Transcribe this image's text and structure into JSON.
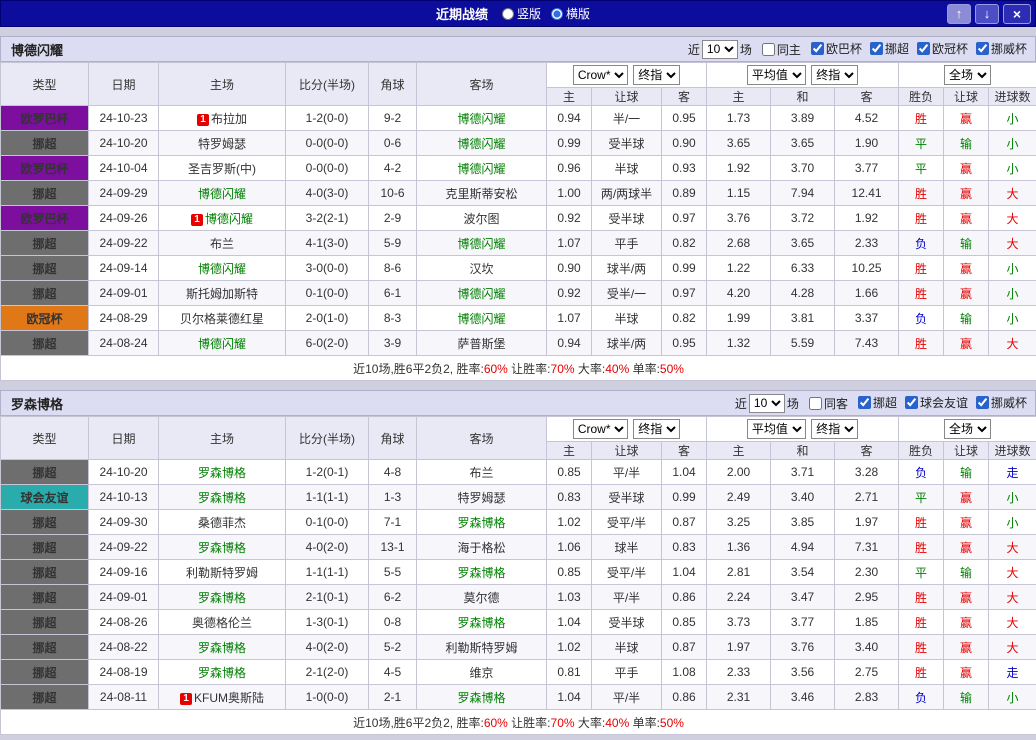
{
  "palette": {
    "focus_team": "#008000",
    "score": "#e60000",
    "accent": "#0d0d9d"
  },
  "result_colors": {
    "胜": "#e60000",
    "平": "#008000",
    "负": "#0000cc",
    "赢": "#e60000",
    "输": "#008000",
    "大": "#e60000",
    "小": "#008000",
    "走": "#0000cc"
  },
  "type_colors": {
    "挪超": "#6e6e6e",
    "欧罗巴杯": "#7d0f9e",
    "欧冠杯": "#e07818",
    "球会友谊": "#2aacac"
  },
  "topbar": {
    "title": "近期战绩",
    "radios": [
      {
        "label": "竖版",
        "selected": false
      },
      {
        "label": "横版",
        "selected": true
      }
    ],
    "up": "↑",
    "down": "↓",
    "close": "×"
  },
  "columns": {
    "type": "类型",
    "date": "日期",
    "home": "主场",
    "score": "比分(半场)",
    "corners": "角球",
    "away": "客场",
    "crow": "Crow*",
    "final1": "终指",
    "avg": "平均值",
    "final2": "终指",
    "full": "全场",
    "h1": "主",
    "hcap1": "让球",
    "a1": "客",
    "h2": "主",
    "draw2": "和",
    "a2": "客",
    "wdl": "胜负",
    "hcap2": "让球",
    "goals": "进球数"
  },
  "filter_labels": {
    "near": "近",
    "count": "10",
    "games": "场"
  },
  "sections": [
    {
      "team": "博德闪耀",
      "same_label": "同主",
      "same_checked": false,
      "leagues": [
        {
          "label": "欧巴杯",
          "checked": true
        },
        {
          "label": "挪超",
          "checked": true
        },
        {
          "label": "欧冠杯",
          "checked": true
        },
        {
          "label": "挪威杯",
          "checked": true
        }
      ],
      "rows": [
        {
          "type": "欧罗巴杯",
          "date": "24-10-23",
          "home": "布拉加",
          "hb": true,
          "hg": false,
          "score": "1-2(0-0)",
          "corners": "9-2",
          "away": "博德闪耀",
          "ab": false,
          "ag": true,
          "o": [
            "0.94",
            "半/一",
            "0.95"
          ],
          "avg": [
            "1.73",
            "3.89",
            "4.52"
          ],
          "res": [
            "胜",
            "赢",
            "小"
          ]
        },
        {
          "type": "挪超",
          "date": "24-10-20",
          "home": "特罗姆瑟",
          "hb": false,
          "hg": false,
          "score": "0-0(0-0)",
          "corners": "0-6",
          "away": "博德闪耀",
          "ab": false,
          "ag": true,
          "o": [
            "0.99",
            "受半球",
            "0.90"
          ],
          "avg": [
            "3.65",
            "3.65",
            "1.90"
          ],
          "res": [
            "平",
            "输",
            "小"
          ]
        },
        {
          "type": "欧罗巴杯",
          "date": "24-10-04",
          "home": "圣吉罗斯(中)",
          "hb": false,
          "hg": false,
          "score": "0-0(0-0)",
          "corners": "4-2",
          "away": "博德闪耀",
          "ab": false,
          "ag": true,
          "o": [
            "0.96",
            "半球",
            "0.93"
          ],
          "avg": [
            "1.92",
            "3.70",
            "3.77"
          ],
          "res": [
            "平",
            "赢",
            "小"
          ]
        },
        {
          "type": "挪超",
          "date": "24-09-29",
          "home": "博德闪耀",
          "hb": false,
          "hg": true,
          "score": "4-0(3-0)",
          "corners": "10-6",
          "away": "克里斯蒂安松",
          "ab": false,
          "ag": false,
          "o": [
            "1.00",
            "两/两球半",
            "0.89"
          ],
          "avg": [
            "1.15",
            "7.94",
            "12.41"
          ],
          "res": [
            "胜",
            "赢",
            "大"
          ]
        },
        {
          "type": "欧罗巴杯",
          "date": "24-09-26",
          "home": "博德闪耀",
          "hb": true,
          "hg": true,
          "score": "3-2(2-1)",
          "corners": "2-9",
          "away": "波尔图",
          "ab": false,
          "ag": false,
          "o": [
            "0.92",
            "受半球",
            "0.97"
          ],
          "avg": [
            "3.76",
            "3.72",
            "1.92"
          ],
          "res": [
            "胜",
            "赢",
            "大"
          ]
        },
        {
          "type": "挪超",
          "date": "24-09-22",
          "home": "布兰",
          "hb": false,
          "hg": false,
          "score": "4-1(3-0)",
          "corners": "5-9",
          "away": "博德闪耀",
          "ab": false,
          "ag": true,
          "o": [
            "1.07",
            "平手",
            "0.82"
          ],
          "avg": [
            "2.68",
            "3.65",
            "2.33"
          ],
          "res": [
            "负",
            "输",
            "大"
          ]
        },
        {
          "type": "挪超",
          "date": "24-09-14",
          "home": "博德闪耀",
          "hb": false,
          "hg": true,
          "score": "3-0(0-0)",
          "corners": "8-6",
          "away": "汉坎",
          "ab": false,
          "ag": false,
          "o": [
            "0.90",
            "球半/两",
            "0.99"
          ],
          "avg": [
            "1.22",
            "6.33",
            "10.25"
          ],
          "res": [
            "胜",
            "赢",
            "小"
          ]
        },
        {
          "type": "挪超",
          "date": "24-09-01",
          "home": "斯托姆加斯特",
          "hb": false,
          "hg": false,
          "score": "0-1(0-0)",
          "corners": "6-1",
          "away": "博德闪耀",
          "ab": false,
          "ag": true,
          "o": [
            "0.92",
            "受半/一",
            "0.97"
          ],
          "avg": [
            "4.20",
            "4.28",
            "1.66"
          ],
          "res": [
            "胜",
            "赢",
            "小"
          ]
        },
        {
          "type": "欧冠杯",
          "date": "24-08-29",
          "home": "贝尔格莱德红星",
          "hb": false,
          "hg": false,
          "score": "2-0(1-0)",
          "corners": "8-3",
          "away": "博德闪耀",
          "ab": false,
          "ag": true,
          "o": [
            "1.07",
            "半球",
            "0.82"
          ],
          "avg": [
            "1.99",
            "3.81",
            "3.37"
          ],
          "res": [
            "负",
            "输",
            "小"
          ]
        },
        {
          "type": "挪超",
          "date": "24-08-24",
          "home": "博德闪耀",
          "hb": false,
          "hg": true,
          "score": "6-0(2-0)",
          "corners": "3-9",
          "away": "萨普斯堡",
          "ab": false,
          "ag": false,
          "o": [
            "0.94",
            "球半/两",
            "0.95"
          ],
          "avg": [
            "1.32",
            "5.59",
            "7.43"
          ],
          "res": [
            "胜",
            "赢",
            "大"
          ]
        }
      ],
      "footer": [
        {
          "t": "近10场,胜6平2负2, 胜率:",
          "c": "#333333"
        },
        {
          "t": "60%",
          "c": "#e60000"
        },
        {
          "t": " 让胜率:",
          "c": "#333333"
        },
        {
          "t": "70%",
          "c": "#e60000"
        },
        {
          "t": " 大率:",
          "c": "#333333"
        },
        {
          "t": "40%",
          "c": "#e60000"
        },
        {
          "t": " 单率:",
          "c": "#333333"
        },
        {
          "t": "50%",
          "c": "#e60000"
        }
      ]
    },
    {
      "team": "罗森博格",
      "same_label": "同客",
      "same_checked": false,
      "leagues": [
        {
          "label": "挪超",
          "checked": true
        },
        {
          "label": "球会友谊",
          "checked": true
        },
        {
          "label": "挪威杯",
          "checked": true
        }
      ],
      "rows": [
        {
          "type": "挪超",
          "date": "24-10-20",
          "home": "罗森博格",
          "hb": false,
          "hg": true,
          "score": "1-2(0-1)",
          "corners": "4-8",
          "away": "布兰",
          "ab": false,
          "ag": false,
          "o": [
            "0.85",
            "平/半",
            "1.04"
          ],
          "avg": [
            "2.00",
            "3.71",
            "3.28"
          ],
          "res": [
            "负",
            "输",
            "走"
          ]
        },
        {
          "type": "球会友谊",
          "date": "24-10-13",
          "home": "罗森博格",
          "hb": false,
          "hg": true,
          "score": "1-1(1-1)",
          "corners": "1-3",
          "away": "特罗姆瑟",
          "ab": false,
          "ag": false,
          "o": [
            "0.83",
            "受半球",
            "0.99"
          ],
          "avg": [
            "2.49",
            "3.40",
            "2.71"
          ],
          "res": [
            "平",
            "赢",
            "小"
          ]
        },
        {
          "type": "挪超",
          "date": "24-09-30",
          "home": "桑德菲杰",
          "hb": false,
          "hg": false,
          "score": "0-1(0-0)",
          "corners": "7-1",
          "away": "罗森博格",
          "ab": false,
          "ag": true,
          "o": [
            "1.02",
            "受平/半",
            "0.87"
          ],
          "avg": [
            "3.25",
            "3.85",
            "1.97"
          ],
          "res": [
            "胜",
            "赢",
            "小"
          ]
        },
        {
          "type": "挪超",
          "date": "24-09-22",
          "home": "罗森博格",
          "hb": false,
          "hg": true,
          "score": "4-0(2-0)",
          "corners": "13-1",
          "away": "海于格松",
          "ab": false,
          "ag": false,
          "o": [
            "1.06",
            "球半",
            "0.83"
          ],
          "avg": [
            "1.36",
            "4.94",
            "7.31"
          ],
          "res": [
            "胜",
            "赢",
            "大"
          ]
        },
        {
          "type": "挪超",
          "date": "24-09-16",
          "home": "利勒斯特罗姆",
          "hb": false,
          "hg": false,
          "score": "1-1(1-1)",
          "corners": "5-5",
          "away": "罗森博格",
          "ab": false,
          "ag": true,
          "o": [
            "0.85",
            "受平/半",
            "1.04"
          ],
          "avg": [
            "2.81",
            "3.54",
            "2.30"
          ],
          "res": [
            "平",
            "输",
            "大"
          ]
        },
        {
          "type": "挪超",
          "date": "24-09-01",
          "home": "罗森博格",
          "hb": false,
          "hg": true,
          "score": "2-1(0-1)",
          "corners": "6-2",
          "away": "莫尔德",
          "ab": false,
          "ag": false,
          "o": [
            "1.03",
            "平/半",
            "0.86"
          ],
          "avg": [
            "2.24",
            "3.47",
            "2.95"
          ],
          "res": [
            "胜",
            "赢",
            "大"
          ]
        },
        {
          "type": "挪超",
          "date": "24-08-26",
          "home": "奥德格伦兰",
          "hb": false,
          "hg": false,
          "score": "1-3(0-1)",
          "corners": "0-8",
          "away": "罗森博格",
          "ab": false,
          "ag": true,
          "o": [
            "1.04",
            "受半球",
            "0.85"
          ],
          "avg": [
            "3.73",
            "3.77",
            "1.85"
          ],
          "res": [
            "胜",
            "赢",
            "大"
          ]
        },
        {
          "type": "挪超",
          "date": "24-08-22",
          "home": "罗森博格",
          "hb": false,
          "hg": true,
          "score": "4-0(2-0)",
          "corners": "5-2",
          "away": "利勒斯特罗姆",
          "ab": false,
          "ag": false,
          "o": [
            "1.02",
            "半球",
            "0.87"
          ],
          "avg": [
            "1.97",
            "3.76",
            "3.40"
          ],
          "res": [
            "胜",
            "赢",
            "大"
          ]
        },
        {
          "type": "挪超",
          "date": "24-08-19",
          "home": "罗森博格",
          "hb": false,
          "hg": true,
          "score": "2-1(2-0)",
          "corners": "4-5",
          "away": "维京",
          "ab": false,
          "ag": false,
          "o": [
            "0.81",
            "平手",
            "1.08"
          ],
          "avg": [
            "2.33",
            "3.56",
            "2.75"
          ],
          "res": [
            "胜",
            "赢",
            "走"
          ]
        },
        {
          "type": "挪超",
          "date": "24-08-11",
          "home": "KFUM奥斯陆",
          "hb": true,
          "hg": false,
          "score": "1-0(0-0)",
          "corners": "2-1",
          "away": "罗森博格",
          "ab": false,
          "ag": true,
          "o": [
            "1.04",
            "平/半",
            "0.86"
          ],
          "avg": [
            "2.31",
            "3.46",
            "2.83"
          ],
          "res": [
            "负",
            "输",
            "小"
          ]
        }
      ],
      "footer": [
        {
          "t": "近10场,胜6平2负2, 胜率:",
          "c": "#333333"
        },
        {
          "t": "60%",
          "c": "#e60000"
        },
        {
          "t": " 让胜率:",
          "c": "#333333"
        },
        {
          "t": "70%",
          "c": "#e60000"
        },
        {
          "t": " 大率:",
          "c": "#333333"
        },
        {
          "t": "40%",
          "c": "#e60000"
        },
        {
          "t": " 单率:",
          "c": "#333333"
        },
        {
          "t": "50%",
          "c": "#e60000"
        }
      ]
    }
  ]
}
